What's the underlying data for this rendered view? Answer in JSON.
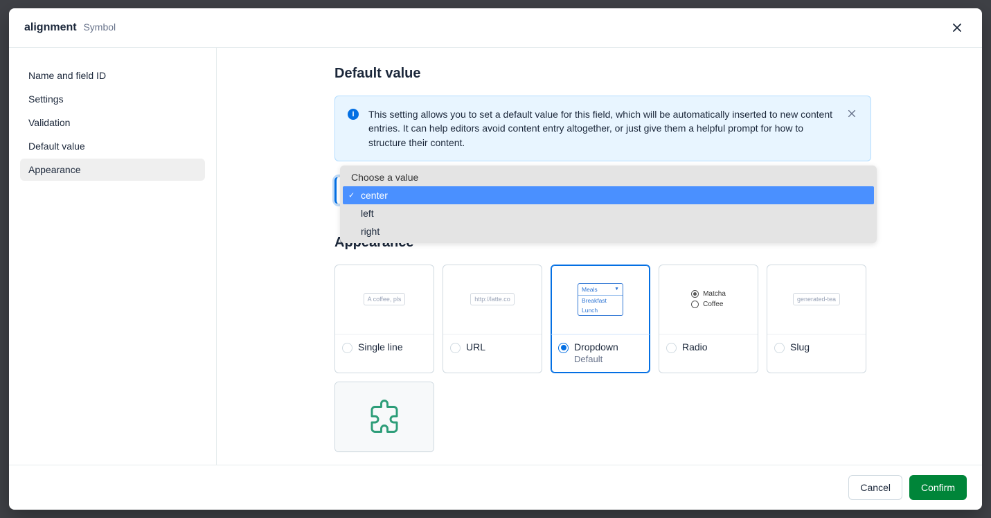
{
  "header": {
    "title": "alignment",
    "subtitle": "Symbol"
  },
  "sidebar": {
    "items": [
      {
        "label": "Name and field ID"
      },
      {
        "label": "Settings"
      },
      {
        "label": "Validation"
      },
      {
        "label": "Default value"
      },
      {
        "label": "Appearance"
      }
    ],
    "active_index": 4
  },
  "default_value": {
    "heading": "Default value",
    "info": "This setting allows you to set a default value for this field, which will be automatically inserted to new content entries. It can help editors avoid content entry altogether, or just give them a helpful prompt for how to structure their content.",
    "dropdown": {
      "placeholder": "Choose a value",
      "selected": "center",
      "options": [
        "center",
        "left",
        "right"
      ]
    }
  },
  "appearance": {
    "heading": "Appearance",
    "selected": "Dropdown",
    "default_label": "Default",
    "cards": [
      {
        "key": "single-line",
        "label": "Single line",
        "preview_text": "A coffee, pls"
      },
      {
        "key": "url",
        "label": "URL",
        "preview_text": "http://latte.co"
      },
      {
        "key": "dropdown",
        "label": "Dropdown",
        "preview": {
          "title": "Meals",
          "items": [
            "Breakfast",
            "Lunch"
          ]
        }
      },
      {
        "key": "radio",
        "label": "Radio",
        "preview": {
          "items": [
            "Matcha",
            "Coffee"
          ],
          "checked": 0
        }
      },
      {
        "key": "slug",
        "label": "Slug",
        "preview_text": "generated-tea"
      }
    ]
  },
  "footer": {
    "cancel": "Cancel",
    "confirm": "Confirm"
  }
}
